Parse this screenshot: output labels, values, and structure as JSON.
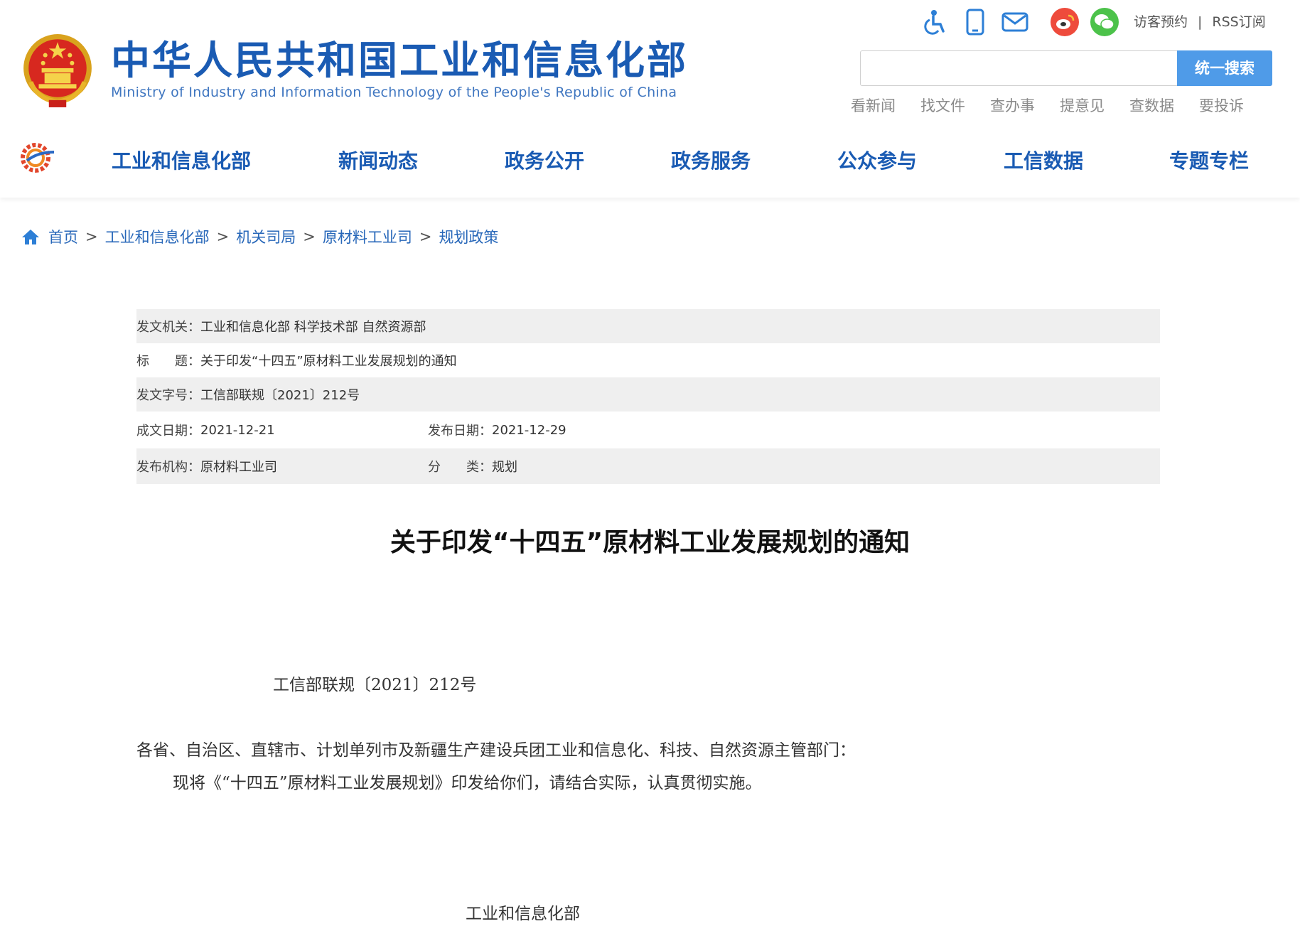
{
  "header": {
    "title_cn": "中华人民共和国工业和信息化部",
    "title_en": "Ministry of Industry and Information Technology of the People's Republic of China",
    "top_icons": [
      "accessibility-icon",
      "mobile-icon",
      "mail-icon",
      "weibo-icon",
      "wechat-icon"
    ],
    "visit": "访客预约",
    "sep": "|",
    "rss": "RSS订阅",
    "search_placeholder": "",
    "search_button": "统一搜索",
    "quick_links": [
      "看新闻",
      "找文件",
      "查办事",
      "提意见",
      "查数据",
      "要投诉"
    ]
  },
  "nav": [
    "工业和信息化部",
    "新闻动态",
    "政务公开",
    "政务服务",
    "公众参与",
    "工信数据",
    "专题专栏"
  ],
  "breadcrumb": [
    "首页",
    "工业和信息化部",
    "机关司局",
    "原材料工业司",
    "规划政策"
  ],
  "breadcrumb_sep": ">",
  "info": {
    "issuer_label": "发文机关：",
    "issuer": "工业和信息化部 科学技术部 自然资源部",
    "title_label": "标　　题：",
    "title": "关于印发“十四五”原材料工业发展规划的通知",
    "docno_label": "发文字号：",
    "docno": "工信部联规〔2021〕212号",
    "written_label": "成文日期：",
    "written": "2021-12-21",
    "published_label": "发布日期：",
    "published": "2021-12-29",
    "org_label": "发布机构：",
    "org": "原材料工业司",
    "category_label": "分　　类：",
    "category": "规划"
  },
  "article": {
    "title": "关于印发“十四五”原材料工业发展规划的通知",
    "doc_number": "工信部联规〔2021〕212号",
    "salutation": "各省、自治区、直辖市、计划单列市及新疆生产建设兵团工业和信息化、科技、自然资源主管部门：",
    "paragraph": "现将《“十四五”原材料工业发展规划》印发给你们，请结合实际，认真贯彻实施。",
    "signature": "工业和信息化部"
  }
}
